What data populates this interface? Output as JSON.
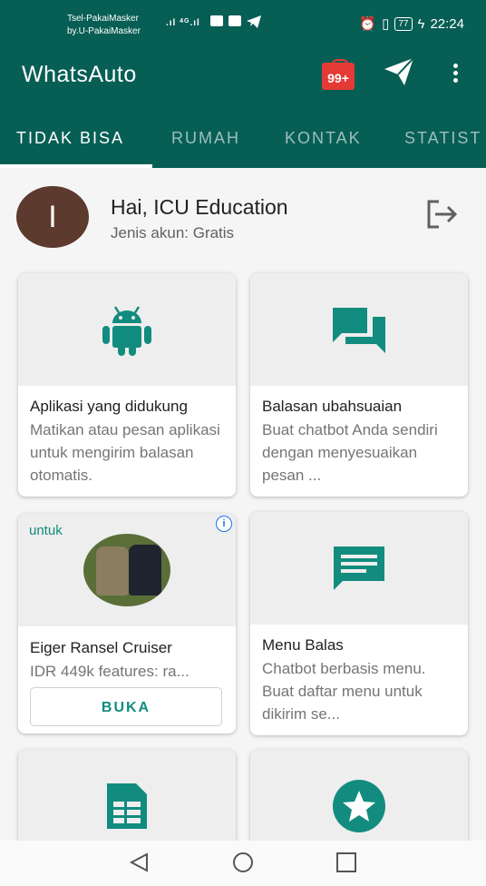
{
  "status": {
    "carrier_line1": "Tsel-PakaiMasker",
    "carrier_line2": "by.U-PakaiMasker",
    "network": "4G",
    "battery": "77",
    "time": "22:24"
  },
  "app": {
    "title": "WhatsAuto",
    "notification_badge": "99+",
    "accent": "#075e54",
    "brand_green": "#128c7e"
  },
  "tabs": [
    {
      "label": "TIDAK BISA"
    },
    {
      "label": "RUMAH"
    },
    {
      "label": "KONTAK"
    },
    {
      "label": "STATIST"
    }
  ],
  "user": {
    "avatar_letter": "I",
    "greeting": "Hai, ICU Education",
    "account_type": "Jenis akun: Gratis"
  },
  "cards": [
    {
      "icon": "android-icon",
      "title": "Aplikasi yang didukung",
      "description": "Matikan atau pesan aplikasi untuk mengirim balasan otomatis."
    },
    {
      "icon": "chat-bubbles-icon",
      "title": "Balasan ubahsuaian",
      "description": "Buat chatbot Anda sendiri dengan menyesuaikan pesan ..."
    },
    {
      "icon": "menu-message-icon",
      "title": "Menu Balas",
      "description": "Chatbot berbasis menu. Buat daftar menu untuk dikirim se..."
    },
    {
      "icon": "spreadsheet-icon"
    },
    {
      "icon": "star-icon"
    }
  ],
  "ad": {
    "label": "untuk",
    "info": "i",
    "title": "Eiger Ransel Cruiser",
    "description": "IDR 449k features: ra...",
    "button": "BUKA"
  },
  "navbar": {
    "back": "back-icon",
    "home": "home-icon",
    "recents": "recents-icon"
  }
}
